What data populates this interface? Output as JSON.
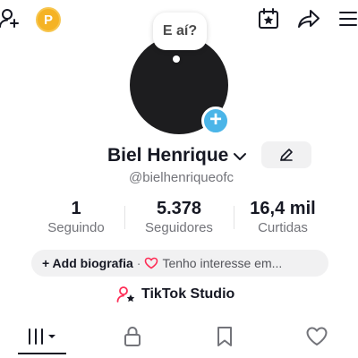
{
  "header": {
    "coin_label": "P",
    "icons": [
      "add-friend-icon",
      "coin-icon",
      "calendar-star-icon",
      "share-icon",
      "menu-icon"
    ]
  },
  "avatar": {
    "note_text": "E aí?",
    "add_symbol": "+"
  },
  "profile": {
    "name": "Biel Henrique",
    "handle": "@bielhenriqueofc"
  },
  "stats": [
    {
      "value": "1",
      "label": "Seguindo"
    },
    {
      "value": "5.378",
      "label": "Seguidores"
    },
    {
      "value": "16,4 mil",
      "label": "Curtidas"
    }
  ],
  "bio": {
    "add_label": "+ Add biografia",
    "separator": "·",
    "interest_label": "Tenho interesse em..."
  },
  "studio": {
    "label": "TikTok Studio"
  },
  "tabs": [
    "videos-grid-icon",
    "lock-icon",
    "bookmark-icon",
    "heart-icon"
  ],
  "colors": {
    "accent_blue": "#4bb5e8",
    "coin": "#f5b324",
    "heart_red": "#fe2c55",
    "pill_bg": "#f1f1f2",
    "muted_text": "#73747a"
  }
}
